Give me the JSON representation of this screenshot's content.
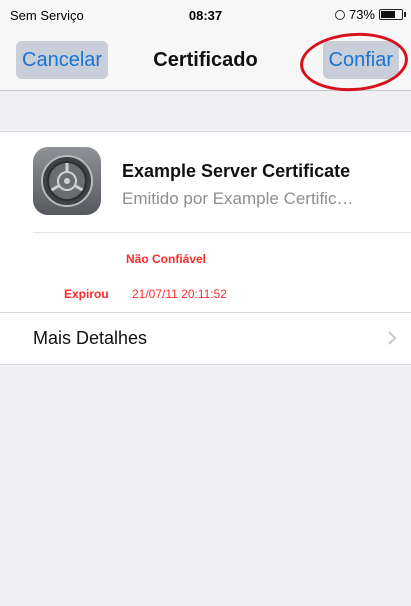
{
  "status_bar": {
    "carrier": "Sem Serviço",
    "time": "08:37",
    "battery": "73%"
  },
  "nav": {
    "cancel_label": "Cancelar",
    "title": "Certificado",
    "confirm_label": "Confiar"
  },
  "certificate": {
    "name": "Example Server Certificate",
    "issuer": "Emitido por Example Certific…",
    "trust_status": "Não Confiável",
    "expired_label": "Expirou",
    "expired_value": "21/07/11 20:11:52"
  },
  "details": {
    "label": "Mais Detalhes"
  },
  "colors": {
    "accent": "#1a73d6",
    "warning": "#ff2b2b",
    "annotation": "#d8121c"
  },
  "icons": [
    "lock-rotation-icon",
    "battery-icon",
    "certificate-gear-icon",
    "chevron-right-icon"
  ]
}
